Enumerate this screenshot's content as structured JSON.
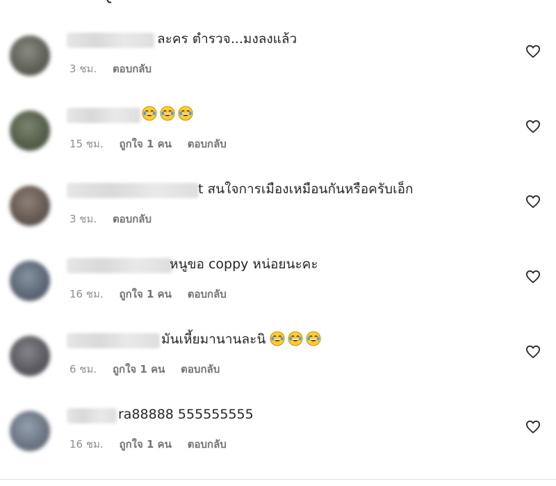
{
  "colors": {
    "text": "#262626",
    "meta": "#8e8e8e",
    "heart": "#262626",
    "emoji_face": "#ffcc33",
    "emoji_tear": "#3aa0ff"
  },
  "comments": [
    {
      "text": "ละคร ตำรวจ...มงลงแล้ว",
      "time": "3 ชม.",
      "likes": "",
      "reply": "ตอบกลับ",
      "emojis": 0,
      "avatar_color": "#6c6f64"
    },
    {
      "text": "",
      "time": "15 ชม.",
      "likes": "ถูกใจ 1 คน",
      "reply": "ตอบกลับ",
      "emojis": 3,
      "emoji_name": "face-with-tears-of-joy-icon",
      "avatar_color": "#5e6650"
    },
    {
      "text": "t สนใจการเมืองเหมือนกันหรือครับเอ็ก",
      "time": "3 ชม.",
      "likes": "",
      "reply": "ตอบกลับ",
      "emojis": 0,
      "avatar_color": "#6f645d"
    },
    {
      "text": "&nbsp;หนูขอ coppy หน่อยนะคะ",
      "time": "16 ชม.",
      "likes": "ถูกใจ 1 คน",
      "reply": "ตอบกลับ",
      "emojis": 0,
      "avatar_color": "#646d7a"
    },
    {
      "text": "มันเหี้ยมานานละนิ",
      "time": "6 ชม.",
      "likes": "ถูกใจ 1 คน",
      "reply": "ตอบกลับ",
      "emojis": 3,
      "emoji_name": "face-with-tears-of-joy-icon",
      "avatar_color": "#5f5e62"
    },
    {
      "text": "ra88888 555555555",
      "time": "16 ชม.",
      "likes": "ถูกใจ 1 คน",
      "reply": "ตอบกลับ",
      "emojis": 0,
      "avatar_color": "#707a86"
    }
  ]
}
